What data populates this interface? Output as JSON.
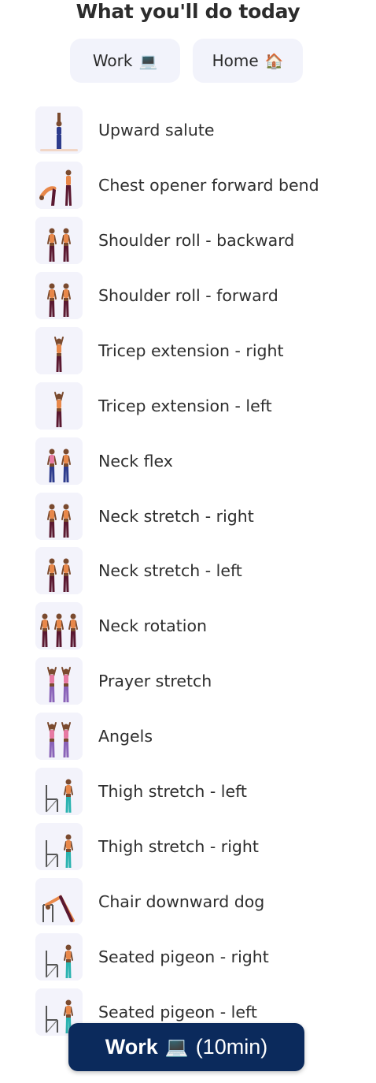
{
  "header": {
    "title": "What you'll do today"
  },
  "tabs": [
    {
      "label": "Work",
      "emoji": "💻"
    },
    {
      "label": "Home",
      "emoji": "🏠"
    }
  ],
  "exercises": [
    {
      "name": "Upward salute",
      "icon": "upward-salute-figure-icon"
    },
    {
      "name": "Chest opener forward bend",
      "icon": "chest-opener-figure-icon"
    },
    {
      "name": "Shoulder roll - backward",
      "icon": "shoulder-roll-backward-figure-icon"
    },
    {
      "name": "Shoulder roll - forward",
      "icon": "shoulder-roll-forward-figure-icon"
    },
    {
      "name": "Tricep extension - right",
      "icon": "tricep-extension-right-figure-icon"
    },
    {
      "name": "Tricep extension - left",
      "icon": "tricep-extension-left-figure-icon"
    },
    {
      "name": "Neck flex",
      "icon": "neck-flex-figure-icon"
    },
    {
      "name": "Neck stretch - right",
      "icon": "neck-stretch-right-figure-icon"
    },
    {
      "name": "Neck stretch - left",
      "icon": "neck-stretch-left-figure-icon"
    },
    {
      "name": "Neck rotation",
      "icon": "neck-rotation-figure-icon"
    },
    {
      "name": "Prayer stretch",
      "icon": "prayer-stretch-figure-icon"
    },
    {
      "name": "Angels",
      "icon": "angels-figure-icon"
    },
    {
      "name": "Thigh stretch - left",
      "icon": "thigh-stretch-left-figure-icon"
    },
    {
      "name": "Thigh stretch - right",
      "icon": "thigh-stretch-right-figure-icon"
    },
    {
      "name": "Chair downward dog",
      "icon": "chair-downward-dog-figure-icon"
    },
    {
      "name": "Seated pigeon - right",
      "icon": "seated-pigeon-right-figure-icon"
    },
    {
      "name": "Seated pigeon - left",
      "icon": "seated-pigeon-left-figure-icon"
    }
  ],
  "start_button": {
    "label": "Work",
    "emoji": "💻",
    "duration": "(10min)"
  },
  "colors": {
    "accent": "#0b2a5c",
    "tab_bg": "#f2f3fb",
    "thumb_bg": "#f3f3fb",
    "skin": "#7a4a2e",
    "top_orange": "#e8884a",
    "pants_maroon": "#5a1830",
    "pants_blue": "#2d3b8c",
    "top_pink": "#e77aa3",
    "pants_purple": "#8a63b8",
    "pants_teal": "#2bb3b0"
  }
}
